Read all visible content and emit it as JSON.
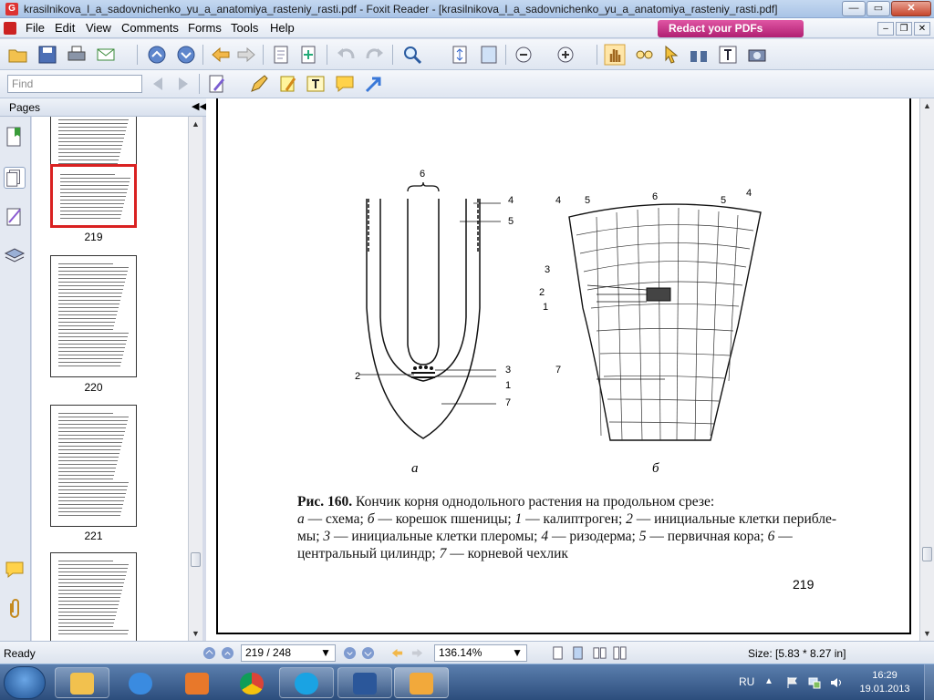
{
  "window": {
    "title": "krasilnikova_l_a_sadovnichenko_yu_a_anatomiya_rasteniy_rasti.pdf - Foxit Reader - [krasilnikova_l_a_sadovnichenko_yu_a_anatomiya_rasteniy_rasti.pdf]",
    "controls": {
      "minimize": "—",
      "maximize": "▭",
      "close": "✕"
    },
    "mdi_controls": {
      "minimize": "–",
      "restore": "❐",
      "close": "✕"
    }
  },
  "menu": {
    "items": [
      "File",
      "Edit",
      "View",
      "Comments",
      "Forms",
      "Tools",
      "Help"
    ],
    "redact_banner": "Redact your PDFs"
  },
  "toolbar": {
    "find_placeholder": "Find"
  },
  "pages_panel": {
    "title": "Pages",
    "collapse_glyph": "◀◀",
    "thumbnails": [
      {
        "label": "",
        "selected": false
      },
      {
        "label": "219",
        "selected": true
      },
      {
        "label": "220",
        "selected": false
      },
      {
        "label": "221",
        "selected": false
      },
      {
        "label": "",
        "selected": false
      }
    ]
  },
  "document": {
    "figure_labels": [
      "а",
      "б"
    ],
    "diagram_a_numbers": [
      "6",
      "4",
      "5",
      "3",
      "2",
      "1",
      "7"
    ],
    "diagram_b_numbers": [
      "4",
      "5",
      "6",
      "5",
      "4",
      "3",
      "2",
      "1",
      "7"
    ],
    "caption": {
      "fig_no": "Рис. 160.",
      "title": " Кончик корня однодольного растения на продольном срезе:",
      "a_letter": "а",
      "a_text": " — схема; ",
      "b_letter": "б",
      "b_text": " — корешок пшеницы; ",
      "n1": "1",
      "t1": " — калиптроген; ",
      "n2": "2",
      "t2": " — инициальные клетки перибле­мы; ",
      "n3": "3",
      "t3": " — инициальные клетки плеромы; ",
      "n4": "4",
      "t4": " — ризодерма; ",
      "n5": "5",
      "t5": " — первичная кора; ",
      "n6": "6",
      "t6": " — центральный цилиндр; ",
      "n7": "7",
      "t7": " — корневой чехлик"
    },
    "page_number": "219"
  },
  "statusbar": {
    "ready": "Ready",
    "page_field": "219 / 248",
    "zoom_field": "136.14%",
    "size": "Size: [5.83 * 8.27 in]"
  },
  "taskbar": {
    "language": "RU",
    "time": "16:29",
    "date": "19.01.2013"
  }
}
